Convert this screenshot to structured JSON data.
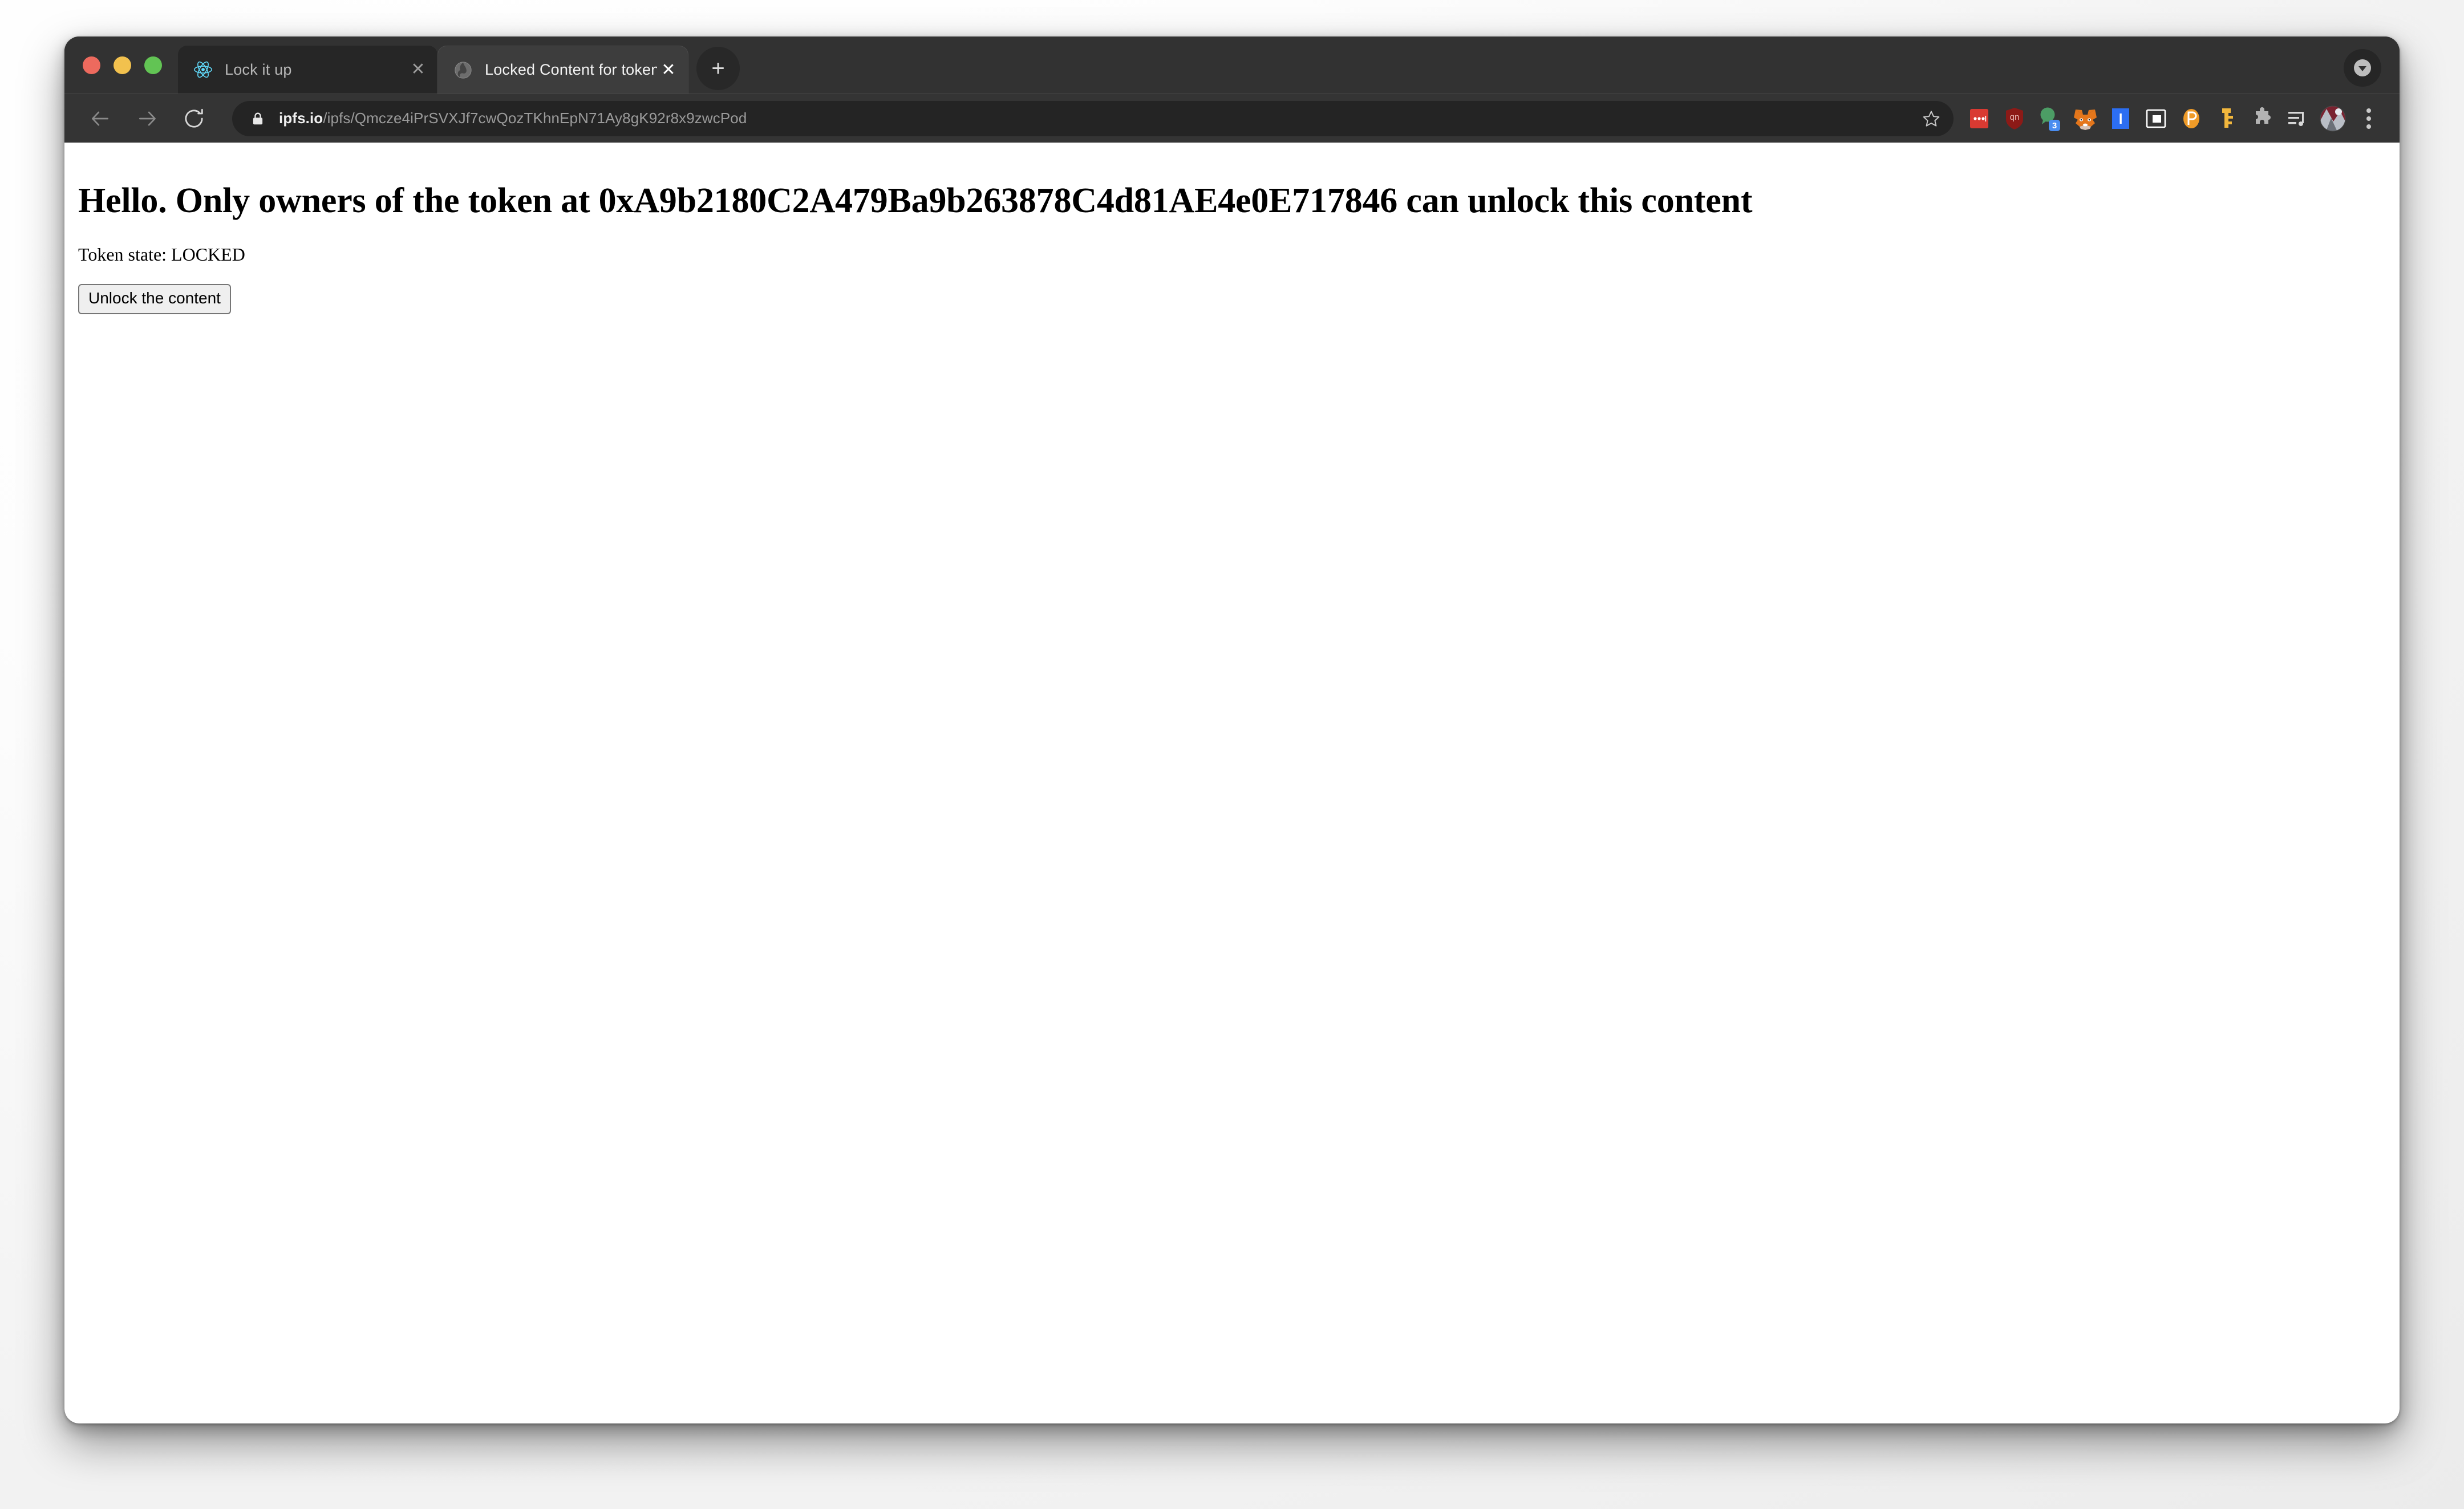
{
  "window": {
    "traffic_lights": [
      {
        "name": "close",
        "color": "#ed6a5e"
      },
      {
        "name": "minimize",
        "color": "#f2c14e"
      },
      {
        "name": "maximize",
        "color": "#62c454"
      }
    ]
  },
  "tabs": [
    {
      "title": "Lock it up",
      "favicon": "react-icon",
      "active": false,
      "close_label": "✕"
    },
    {
      "title": "Locked Content for token holde",
      "favicon": "globe-icon",
      "active": true,
      "close_label": "✕"
    }
  ],
  "tabstrip": {
    "new_tab_label": "+",
    "tab_search_label": ""
  },
  "toolbar": {
    "back_label": "←",
    "forward_label": "→",
    "reload_label": "⟳",
    "menu_label": "",
    "extensions": [
      {
        "name": "red-dots-extension-icon",
        "color": "#d93a32"
      },
      {
        "name": "ublock-origin-shield-icon",
        "color": "#8c1a17"
      },
      {
        "name": "grammarly-bubble-icon",
        "color": "#4c9d65",
        "badge": "3"
      },
      {
        "name": "metamask-fox-icon",
        "color": "#e2761b"
      },
      {
        "name": "blue-square-i-icon",
        "color": "#2c6ef2"
      },
      {
        "name": "picture-in-picture-icon",
        "color": "#ffffff"
      },
      {
        "name": "pocket-p-icon",
        "color": "#ef9b28"
      },
      {
        "name": "gold-key-icon",
        "color": "#f2b73d"
      },
      {
        "name": "puzzle-piece-extensions-icon",
        "color": "#b3b3b3"
      },
      {
        "name": "playlist-music-icon",
        "color": "#d8d8d8"
      },
      {
        "name": "profile-avatar",
        "color": "#7a2230"
      }
    ]
  },
  "omnibox": {
    "security_icon": "lock-icon",
    "host": "ipfs.io",
    "path": "/ipfs/Qmcze4iPrSVXJf7cwQozTKhnEpN71Ay8gK92r8x9zwcPod",
    "bookmark_icon": "star-icon"
  },
  "page": {
    "heading": "Hello. Only owners of the token at 0xA9b2180C2A479Ba9b263878C4d81AE4e0E717846 can unlock this content",
    "token_address": "0xA9b2180C2A479Ba9b263878C4d81AE4e0E717846",
    "token_state_line": "Token state: LOCKED",
    "token_state_value": "LOCKED",
    "unlock_button_label": "Unlock the content"
  }
}
